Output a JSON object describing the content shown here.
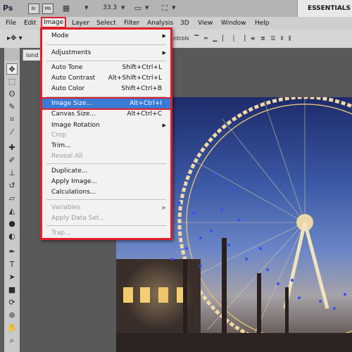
{
  "appbar": {
    "logo": "Ps",
    "bridge_label": "Br",
    "minibridge_label": "Mb",
    "zoom_value": "33.3",
    "workspace_label": "ESSENTIALS"
  },
  "menubar": {
    "items": [
      "File",
      "Edit",
      "Image",
      "Layer",
      "Select",
      "Filter",
      "Analysis",
      "3D",
      "View",
      "Window",
      "Help"
    ]
  },
  "options": {
    "right_fragment": "ntrols"
  },
  "document": {
    "tab_label": "lond"
  },
  "image_menu": {
    "mode": "Mode",
    "adjustments": "Adjustments",
    "auto_tone": "Auto Tone",
    "auto_tone_sc": "Shift+Ctrl+L",
    "auto_contrast": "Auto Contrast",
    "auto_contrast_sc": "Alt+Shift+Ctrl+L",
    "auto_color": "Auto Color",
    "auto_color_sc": "Shift+Ctrl+B",
    "image_size": "Image Size...",
    "image_size_sc": "Alt+Ctrl+I",
    "canvas_size": "Canvas Size...",
    "canvas_size_sc": "Alt+Ctrl+C",
    "image_rotation": "Image Rotation",
    "crop": "Crop",
    "trim": "Trim...",
    "reveal_all": "Reveal All",
    "duplicate": "Duplicate...",
    "apply_image": "Apply Image...",
    "calculations": "Calculations...",
    "variables": "Variables",
    "apply_data_set": "Apply Data Set...",
    "trap": "Trap..."
  },
  "colors": {
    "highlight": "#3a7bd5",
    "annotation_red": "#e0202a",
    "menu_bg": "#f2f2f2"
  },
  "icons": [
    "move-tool-icon",
    "marquee-tool-icon",
    "lasso-tool-icon",
    "quick-selection-icon",
    "crop-tool-icon",
    "eyedropper-icon",
    "healing-brush-icon",
    "brush-tool-icon",
    "clone-stamp-icon",
    "history-brush-icon",
    "eraser-icon",
    "paint-bucket-icon",
    "blur-tool-icon",
    "dodge-tool-icon",
    "pen-tool-icon",
    "type-tool-icon",
    "path-selection-icon",
    "rectangle-tool-icon",
    "3d-rotate-icon",
    "3d-orbit-icon",
    "hand-tool-icon",
    "zoom-tool-icon"
  ]
}
